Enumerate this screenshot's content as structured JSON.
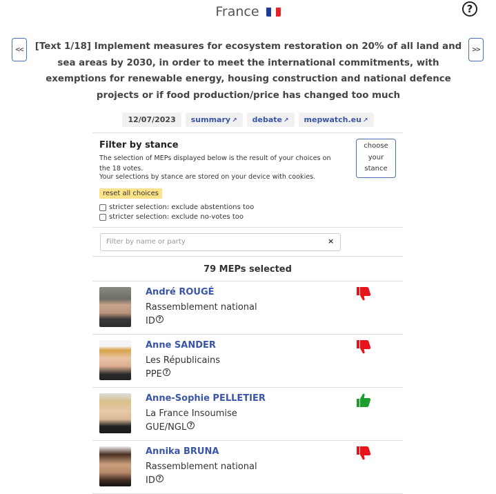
{
  "header": {
    "country": "France",
    "flag_icon": "flag-france-icon",
    "help_label": "?"
  },
  "nav": {
    "prev_label": "<<",
    "next_label": ">>"
  },
  "vote": {
    "title": "[Text 1/18] Implement measures for ecosystem restoration on 20% of all land and sea areas by 2030, in order to meet the international commitments, with exemptions for renewable energy, housing construction and national defence projects or if food production/price has changed too much",
    "date": "12/07/2023",
    "links": [
      "summary",
      "debate",
      "mepwatch.eu"
    ]
  },
  "filter": {
    "heading": "Filter by stance",
    "description": "The selection of MEPs displayed below is the result of your choices on the 18 votes.",
    "cookie_note": "Your selections by stance are stored on your device with cookies.",
    "reset_label": "reset all choices",
    "choose_line1": "choose",
    "choose_line2": "your",
    "choose_line3": "stance",
    "stricter_abstentions": "stricter selection: exclude abstentions too",
    "stricter_novotes": "stricter selection: exclude no-votes too"
  },
  "search": {
    "placeholder": "Filter by name or party",
    "clear_label": "×"
  },
  "results": {
    "count_text": "79 MEPs selected"
  },
  "meps": [
    {
      "name": "André ROUGÉ",
      "party": "Rassemblement national",
      "group": "ID",
      "vote": "against"
    },
    {
      "name": "Anne SANDER",
      "party": "Les Républicains",
      "group": "PPE",
      "vote": "against"
    },
    {
      "name": "Anne-Sophie PELLETIER",
      "party": "La France Insoumise",
      "group": "GUE/NGL",
      "vote": "for"
    },
    {
      "name": "Annika BRUNA",
      "party": "Rassemblement national",
      "group": "ID",
      "vote": "against"
    }
  ],
  "colors": {
    "link": "#3a55a8",
    "vote_against": "#e8141c",
    "vote_for": "#1e9e2e",
    "reset_bg": "#fce38a"
  }
}
